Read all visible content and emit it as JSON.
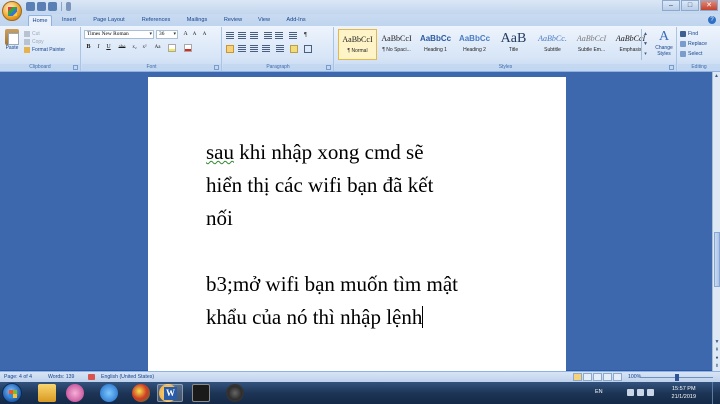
{
  "app": {
    "title_window_controls": [
      "–",
      "□",
      "✕"
    ]
  },
  "tabs": [
    "Home",
    "Insert",
    "Page Layout",
    "References",
    "Mailings",
    "Review",
    "View",
    "Add-Ins"
  ],
  "ribbon": {
    "clipboard": {
      "paste_label": "Paste",
      "cut_label": "Cut",
      "copy_label": "Copy",
      "format_painter_label": "Format Painter",
      "group_label": "Clipboard"
    },
    "font": {
      "font_name": "Times New Roman",
      "font_size": "36",
      "bold": "B",
      "italic": "I",
      "underline": "U",
      "strikethrough": "abe",
      "subscript": "x₂",
      "superscript": "x²",
      "change_case": "Aa",
      "grow": "A",
      "shrink": "A",
      "clear_format": "A",
      "group_label": "Font"
    },
    "paragraph": {
      "group_label": "Paragraph"
    },
    "styles": {
      "items": [
        {
          "sample": "AaBbCcI",
          "name": "¶ Normal",
          "selected": true
        },
        {
          "sample": "AaBbCcI",
          "name": "¶ No Spaci...",
          "selected": false
        },
        {
          "sample": "AaBbCc",
          "name": "Heading 1",
          "selected": false
        },
        {
          "sample": "AaBbCc",
          "name": "Heading 2",
          "selected": false
        },
        {
          "sample": "AaB",
          "name": "Title",
          "selected": false
        },
        {
          "sample": "AaBbCc.",
          "name": "Subtitle",
          "selected": false
        },
        {
          "sample": "AaBbCcI",
          "name": "Subtle Em...",
          "selected": false
        },
        {
          "sample": "AaBbCcI",
          "name": "Emphasis",
          "selected": false
        }
      ],
      "change_styles_label": "Change Styles",
      "group_label": "Styles"
    },
    "editing": {
      "find_label": "Find",
      "replace_label": "Replace",
      "select_label": "Select",
      "group_label": "Editing"
    }
  },
  "document": {
    "line1_word1": "sau",
    "line1_rest": " khi nhập xong cmd sẽ",
    "line2": "hiển thị các wifi bạn đã kết",
    "line3": "nối",
    "line4": "b3;mở wifi bạn muốn tìm mật",
    "line5": "khẩu của nó thì nhập lệnh"
  },
  "status": {
    "page": "Page: 4 of 4",
    "words": "Words: 139",
    "language": "English (United States)",
    "zoom": "100%"
  },
  "taskbar": {
    "lang": "EN",
    "time": "15:57 PM",
    "date": "21/1/2019"
  },
  "colors": {
    "doc_background": "#3e68ad",
    "ribbon_text": "#15428b",
    "spelling_squiggle": "#2d8a2d"
  }
}
